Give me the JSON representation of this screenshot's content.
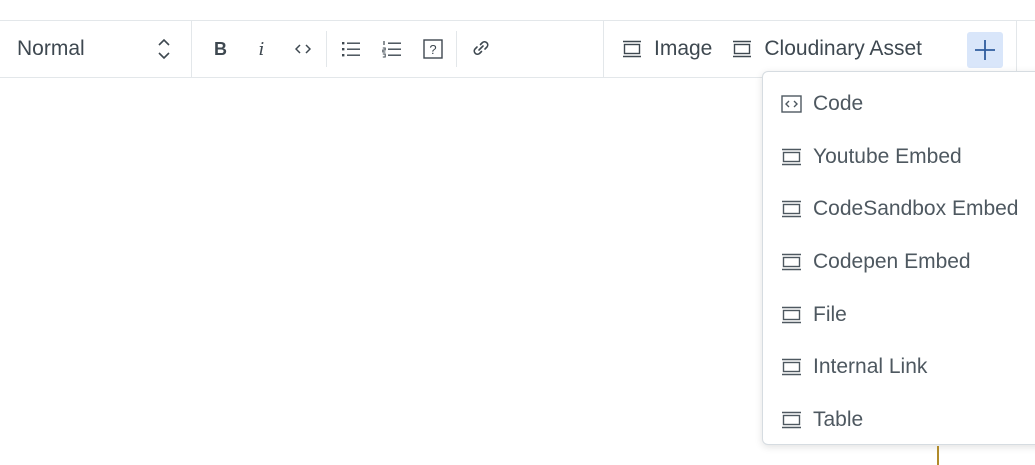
{
  "toolbar": {
    "style_select": {
      "value": "Normal",
      "icon": "chevron-up-down-icon"
    },
    "format_buttons": {
      "bold_label": "B",
      "italic_label": "i",
      "code": "code-icon",
      "bullet_list": "bullet-list-icon",
      "numbered_list": "numbered-list-icon",
      "question": "question-box-icon",
      "link": "link-icon"
    },
    "insert_buttons": [
      {
        "label": "Image",
        "icon": "block-icon"
      },
      {
        "label": "Cloudinary Asset",
        "icon": "block-icon"
      }
    ],
    "add_button_icon": "plus-icon",
    "add_button_bg": "#d9e6fa"
  },
  "dropdown": {
    "items": [
      {
        "label": "Code",
        "icon": "code-box-icon"
      },
      {
        "label": "Youtube Embed",
        "icon": "block-icon"
      },
      {
        "label": "CodeSandbox Embed",
        "icon": "block-icon"
      },
      {
        "label": "Codepen Embed",
        "icon": "block-icon"
      },
      {
        "label": "File",
        "icon": "block-icon"
      },
      {
        "label": "Internal Link",
        "icon": "block-icon"
      },
      {
        "label": "Table",
        "icon": "block-icon"
      }
    ]
  },
  "colors": {
    "text": "#3e4850",
    "border": "#e3e7ea",
    "accent": "#2f5d9e"
  }
}
